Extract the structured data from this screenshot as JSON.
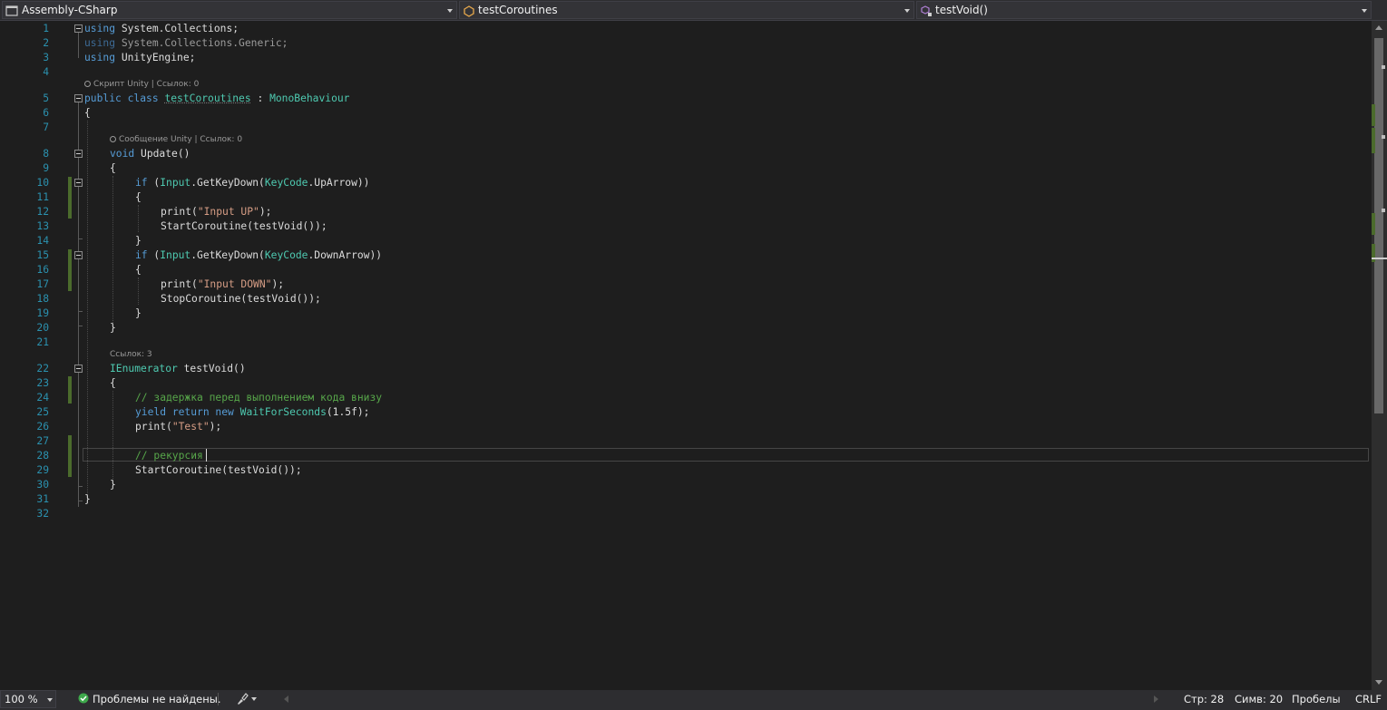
{
  "navbar": {
    "project": "Assembly-CSharp",
    "class": "testCoroutines",
    "member": "testVoid()"
  },
  "editor": {
    "line_numbers": [
      "1",
      "2",
      "3",
      "4",
      "5",
      "6",
      "7",
      "8",
      "9",
      "10",
      "11",
      "12",
      "13",
      "14",
      "15",
      "16",
      "17",
      "18",
      "19",
      "20",
      "21",
      "22",
      "23",
      "24",
      "25",
      "26",
      "27",
      "28",
      "29",
      "30",
      "31",
      "32"
    ],
    "lens": {
      "class": "Скрипт Unity | Ссылок: 0",
      "update": "Сообщение Unity | Ссылок: 0",
      "testvoid": "Ссылок: 3"
    },
    "code": {
      "l1": {
        "kw": "using",
        "rest": " System.Collections;"
      },
      "l2": {
        "kw": "using",
        "rest": " System.Collections.Generic;"
      },
      "l3": {
        "kw": "using",
        "rest": " UnityEngine;"
      },
      "l5": {
        "kw": "public class",
        "name": "testCoroutines",
        "sep": " : ",
        "base": "MonoBehaviour"
      },
      "l6": "{",
      "l8": {
        "kw": "void",
        "rest": " Update()"
      },
      "l9": "{",
      "l10": {
        "kw": "if",
        "p1": " (",
        "t1": "Input",
        "p2": ".GetKeyDown(",
        "t2": "KeyCode",
        "p3": ".UpArrow))"
      },
      "l11": "{",
      "l12": {
        "p1": "print(",
        "s": "\"Input UP\"",
        "p2": ");"
      },
      "l13": "StartCoroutine(testVoid());",
      "l14": "}",
      "l15": {
        "kw": "if",
        "p1": " (",
        "t1": "Input",
        "p2": ".GetKeyDown(",
        "t2": "KeyCode",
        "p3": ".DownArrow))"
      },
      "l16": "{",
      "l17": {
        "p1": "print(",
        "s": "\"Input DOWN\"",
        "p2": ");"
      },
      "l18": "StopCoroutine(testVoid());",
      "l19": "}",
      "l20": "}",
      "l22": {
        "t": "IEnumerator",
        "rest": " testVoid()"
      },
      "l23": "{",
      "l24": "// задержка перед выполнением кода внизу",
      "l25": {
        "kw1": "yield",
        "kw2": " return",
        "kw3": " new",
        "sp": " ",
        "t": "WaitForSeconds",
        "rest": "(1.5f);"
      },
      "l26": {
        "p1": "print(",
        "s": "\"Test\"",
        "p2": ");"
      },
      "l28": "// рекурсия",
      "l29": "StartCoroutine(testVoid());",
      "l30": "}",
      "l31": "}"
    }
  },
  "status": {
    "zoom": "100 %",
    "problems": "Проблемы не найдены.",
    "line": "Стр: 28",
    "col": "Симв: 20",
    "spaces": "Пробелы",
    "eol": "CRLF"
  },
  "colors": {
    "keyword": "#569cd6",
    "type": "#4ec9b0",
    "string": "#d69d85",
    "comment": "#57a64a",
    "line_number": "#2b91af",
    "change_marker": "#4b6b2c"
  }
}
